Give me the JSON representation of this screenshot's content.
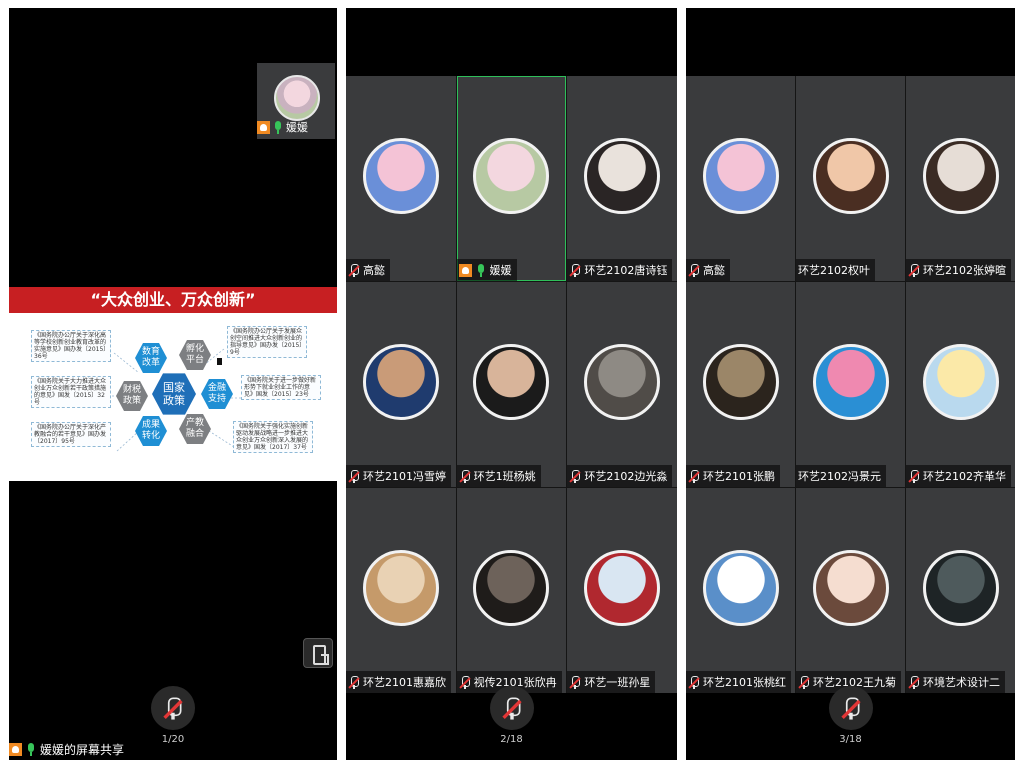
{
  "screen1": {
    "self_name": "媛媛",
    "slide_title": "“大众创业、万众创新”",
    "hex": {
      "center": "国家\n政策",
      "top_left": "数育\n改革",
      "top_right": "孵化\n平台",
      "left": "财税\n政策",
      "right": "金融\n支持",
      "bottom_left": "成果\n转化",
      "bottom_right": "产教\n融合"
    },
    "refs": [
      "《国务院办公厅关于深化高等学校创新创业教育改革的实施意见》国办发〔2015〕36号",
      "《国务院办公厅关于发展众创空间推进大众创新创业的指导意见》国办发〔2015〕9号",
      "《国务院关于大力推进大众创业万众创新若干政策措施的意见》国发〔2015〕32号",
      "《国务院关于进一步做好新形势下就业创业工作的意见》国发〔2015〕23号",
      "《国务院办公厅关于深化产教融合的若干意见》国办发〔2017〕95号",
      "《国务院关于强化实施创新驱动发展战略进一步推进大众创业万众创新深入发展的意见》国发〔2017〕37号"
    ],
    "share_label": "媛媛的屏幕共享",
    "pager": "1/20"
  },
  "screen2": {
    "pager": "2/18",
    "tiles": [
      {
        "name": "高懿",
        "c1": "#f4c3d6",
        "c2": "#6a8fd8",
        "mic": "muted"
      },
      {
        "name": "媛媛",
        "c1": "#f3d7df",
        "c2": "#b7c9a3",
        "mic": "green",
        "host": true,
        "active": true
      },
      {
        "name": "环艺2102唐诗钰",
        "c1": "#e9e2dc",
        "c2": "#2a2525",
        "mic": "muted"
      },
      {
        "name": "环艺2101冯雪婷",
        "c1": "#c99b78",
        "c2": "#1f3b6e",
        "mic": "muted"
      },
      {
        "name": "环艺1班杨姚",
        "c1": "#d8b49a",
        "c2": "#1b1b1b",
        "mic": "muted"
      },
      {
        "name": "环艺2102边光淼",
        "c1": "#8e8a84",
        "c2": "#504c48",
        "mic": "muted"
      },
      {
        "name": "环艺2101惠嘉欣",
        "c1": "#e9d2b4",
        "c2": "#c59a6a",
        "mic": "muted"
      },
      {
        "name": "视传2101张欣冉",
        "c1": "#6d625a",
        "c2": "#1f1c1a",
        "mic": "muted"
      },
      {
        "name": "环艺一班孙星",
        "c1": "#d9e6f2",
        "c2": "#b0282f",
        "mic": "muted"
      }
    ]
  },
  "screen3": {
    "pager": "3/18",
    "tiles": [
      {
        "name": "高懿",
        "c1": "#f4c3d6",
        "c2": "#6a8fd8",
        "mic": "muted"
      },
      {
        "name": "环艺2102权叶",
        "c1": "#f0c7a8",
        "c2": "#4a2e22",
        "mic": "none"
      },
      {
        "name": "环艺2102张婷暄",
        "c1": "#e6ddd6",
        "c2": "#3a2b24",
        "mic": "muted"
      },
      {
        "name": "环艺2101张鹏",
        "c1": "#9b8668",
        "c2": "#2b241d",
        "mic": "muted"
      },
      {
        "name": "环艺2102冯景元",
        "c1": "#ef89b0",
        "c2": "#2a8fd4",
        "mic": "none"
      },
      {
        "name": "环艺2102齐革华",
        "c1": "#fbe9a8",
        "c2": "#b9d9ee",
        "mic": "muted"
      },
      {
        "name": "环艺2101张桃红",
        "c1": "#ffffff",
        "c2": "#5a8fc9",
        "mic": "muted"
      },
      {
        "name": "环艺2102王九菊",
        "c1": "#f5ddd0",
        "c2": "#6b4a3c",
        "mic": "muted"
      },
      {
        "name": "环境艺术设计二",
        "c1": "#4e5a5c",
        "c2": "#1e2426",
        "mic": "muted"
      }
    ]
  },
  "colors": {
    "tile_bg": "#3a3b3d",
    "slide_red": "#c71f22",
    "host_orange": "#f08a22",
    "mic_green": "#37c55a",
    "active_border": "#2fbf5a"
  },
  "icons": {
    "host": "host-icon",
    "mic_on": "mic-icon",
    "mic_off": "mic-muted-icon",
    "rotate": "rotate-screen-icon"
  }
}
